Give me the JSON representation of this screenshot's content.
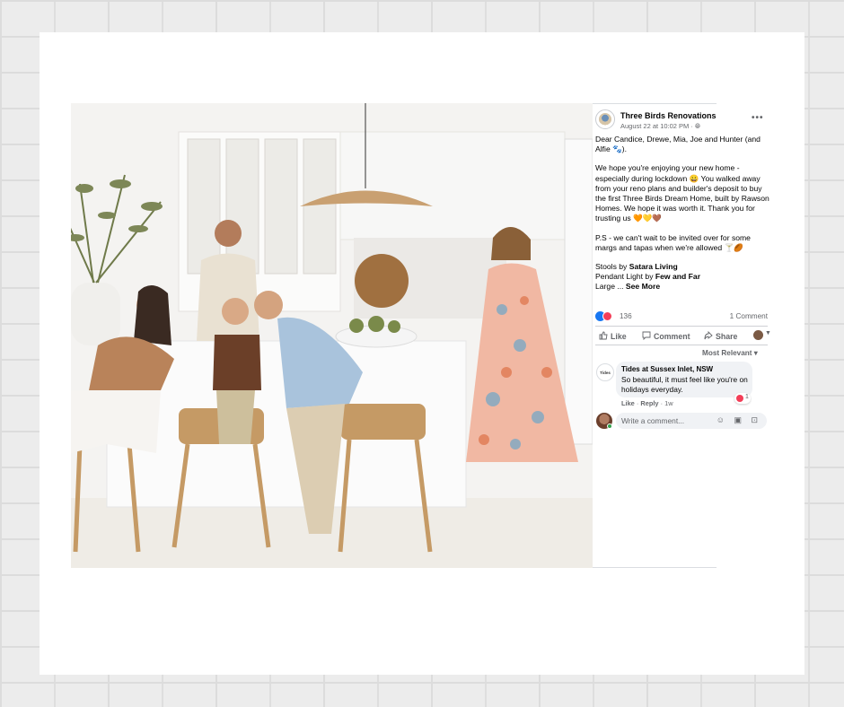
{
  "colors": {
    "fb_blue": "#1877f2",
    "love_red": "#f33e58",
    "text_gray": "#65676b",
    "bubble_gray": "#f0f2f5"
  },
  "post": {
    "page_name": "Three Birds Renovations",
    "date": "August 22 at 10:02 PM · ",
    "globe_icon": "globe-icon",
    "more_icon": "more-options-icon",
    "more_label": "•••",
    "body": {
      "p1": "Dear Candice, Drewe, Mia, Joe and Hunter (and Alfie 🐾).",
      "p2": "We hope you're enjoying your new home - especially during lockdown 😀 You walked away from your reno plans and builder's deposit to buy the first Three Birds Dream Home, built by Rawson Homes. We hope it was worth it. Thank you for trusting us 🧡💛🤎",
      "p3": "P.S - we can't wait to be invited over for some margs and tapas when we're allowed 🍸🏉",
      "stools_prefix": "Stools by ",
      "stools_brand": "Satara Living",
      "pendant_prefix": "Pendant Light by ",
      "pendant_brand": "Few and Far",
      "large_prefix": "Large ... ",
      "see_more": "See More"
    },
    "reaction_count": "136",
    "comment_count": "1 Comment",
    "actions": {
      "like": "Like",
      "comment": "Comment",
      "share": "Share"
    },
    "sort_label": "Most Relevant ▾"
  },
  "comment": {
    "avatar_text": "Tides",
    "author": "Tides at Sussex Inlet, NSW",
    "text": "So beautiful, it must feel like you're on holidays everyday.",
    "reaction_count": "1",
    "like": "Like",
    "reply": "Reply",
    "age": "1w",
    "meta_sep": " · "
  },
  "composer": {
    "placeholder": "Write a comment...",
    "icons": "☺ ▣ ⊡"
  }
}
